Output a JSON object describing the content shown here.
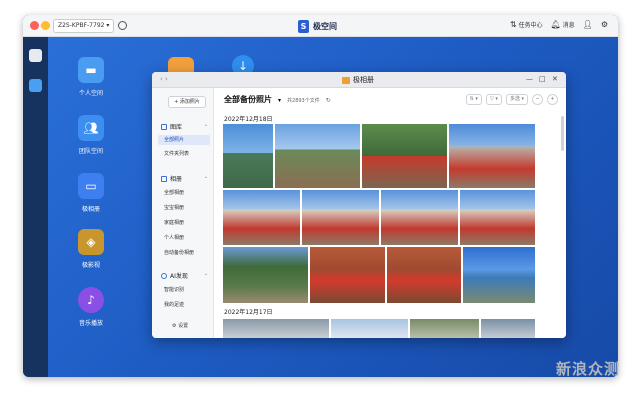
{
  "topbar": {
    "device_name": "Z2S-KPBF-7792",
    "brand_name": "极空间",
    "task_center": "任务中心",
    "messages": "消息"
  },
  "apps": [
    {
      "label": "个人空间",
      "icon": "folder-icon",
      "color": "#4a9cf0"
    },
    {
      "label": "团队空间",
      "icon": "team-folder-icon",
      "color": "#3c8ff0"
    },
    {
      "label": "极相册",
      "icon": "photo-album-icon",
      "color": "#3d7ff0"
    },
    {
      "label": "极影视",
      "icon": "video-icon",
      "color": "#c9962e"
    },
    {
      "label": "音乐播放",
      "icon": "music-icon",
      "color": "#8a4fe6"
    }
  ],
  "photos_window": {
    "title": "极相册",
    "add_button": "添加照片",
    "library_header": "图库",
    "library_items": [
      "全部照片",
      "文件夹列表"
    ],
    "albums_header": "相册",
    "album_items": [
      "全部相册",
      "宝宝相册",
      "家庭相册",
      "个人相册",
      "自动备份相册"
    ],
    "ai_header": "AI发现",
    "ai_items": [
      "智能识别",
      "我的足迹"
    ],
    "settings": "设置",
    "main_title": "全部备份照片",
    "photo_count": "共2893个文件",
    "select_label": "多选",
    "date_groups": [
      "2022年12月18日",
      "2022年12月17日"
    ]
  },
  "watermark": "新浪众测",
  "colors": {
    "desktop": "#1d5bc2",
    "accent": "#1a4fc4"
  }
}
